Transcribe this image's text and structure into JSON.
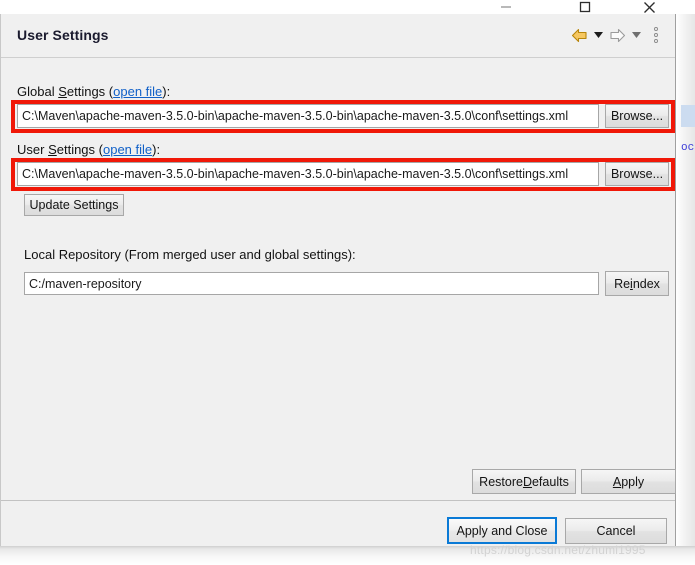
{
  "window": {
    "controls": [
      {
        "name": "minimize",
        "glyph": "—"
      },
      {
        "name": "maximize",
        "glyph": "☐"
      },
      {
        "name": "close",
        "glyph": "✕"
      }
    ]
  },
  "header": {
    "title": "User Settings",
    "back_tooltip": "Back",
    "forward_tooltip": "Forward",
    "menu_tooltip": "View Menu"
  },
  "global_settings": {
    "label_before": "Global ",
    "label_mnemonic": "S",
    "label_after": "ettings (",
    "link": "open file",
    "label_end": "):",
    "path": "C:\\Maven\\apache-maven-3.5.0-bin\\apache-maven-3.5.0-bin\\apache-maven-3.5.0\\conf\\settings.xml",
    "browse_label": "Browse..."
  },
  "user_settings": {
    "label_before": "User ",
    "label_mnemonic": "S",
    "label_after": "ettings (",
    "link": "open file",
    "label_end": "):",
    "path": "C:\\Maven\\apache-maven-3.5.0-bin\\apache-maven-3.5.0-bin\\apache-maven-3.5.0\\conf\\settings.xml",
    "browse_label": "Browse..."
  },
  "update_settings": {
    "label": "Update Settings"
  },
  "local_repository": {
    "label": "Local Repository (From merged user and global settings):",
    "path": "C:/maven-repository",
    "reindex_before": "Re",
    "reindex_mnemonic": "i",
    "reindex_after": "ndex"
  },
  "page_buttons": {
    "restore_before": "Restore ",
    "restore_mnemonic": "D",
    "restore_after": "efaults",
    "apply_mnemonic": "A",
    "apply_after": "pply"
  },
  "footer_buttons": {
    "apply_and_close": "Apply and Close",
    "cancel": "Cancel"
  },
  "background": {
    "code_fragment": "oc"
  },
  "watermark": {
    "text": "https://blog.csdn.net/zhumi1995"
  },
  "colors": {
    "annotation_red": "#f01808",
    "link_blue": "#1060c8",
    "focus_blue": "#0a7ad6",
    "dialog_bg": "#f0f0f0",
    "field_bg": "#ffffff"
  }
}
